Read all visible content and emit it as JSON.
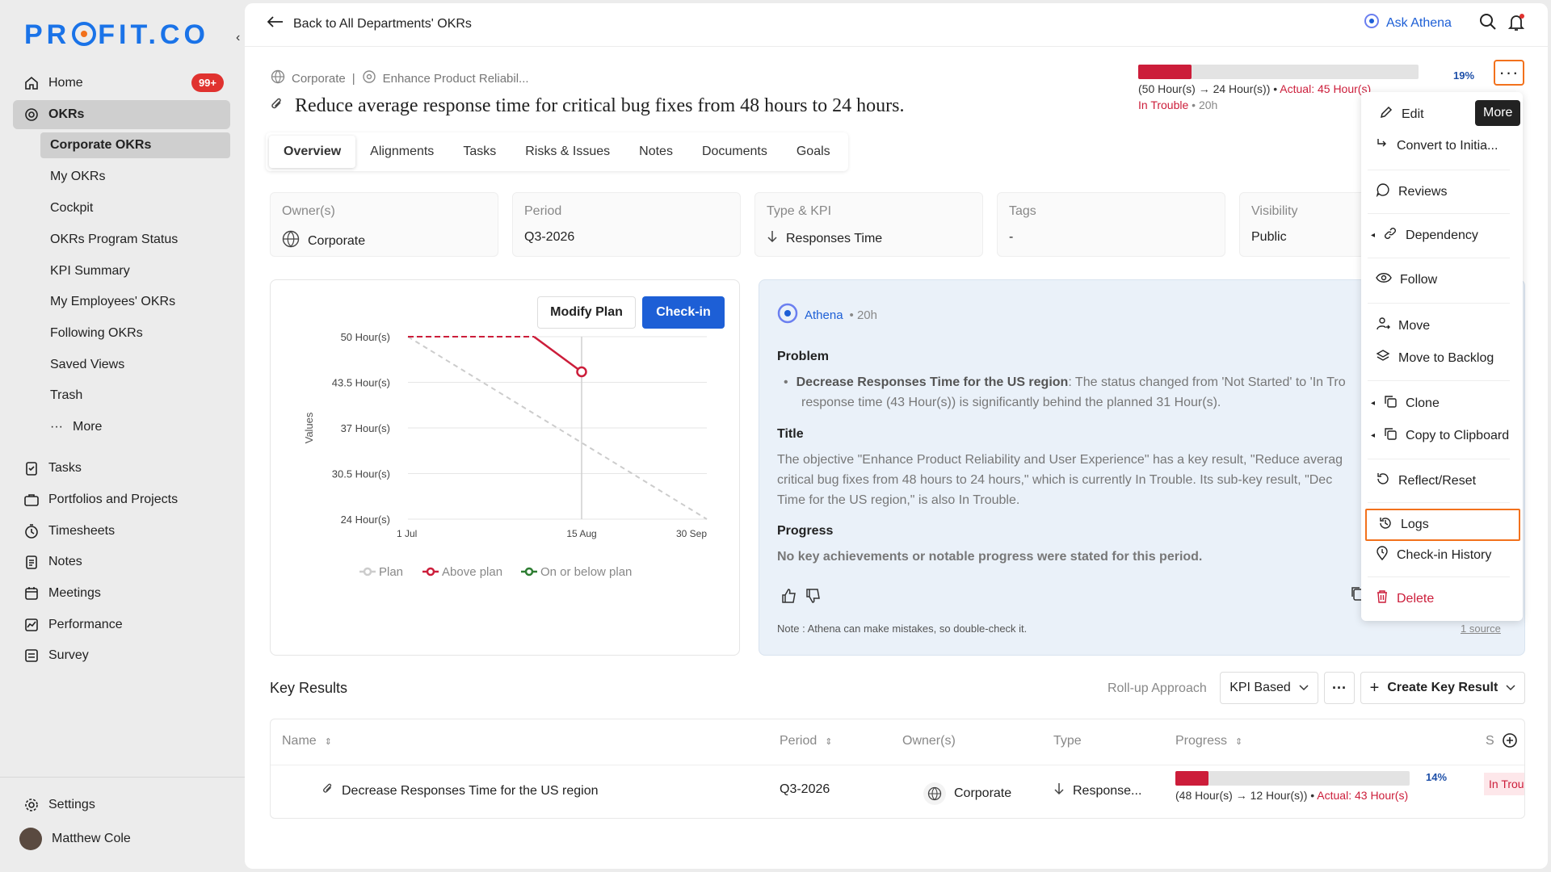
{
  "sidebar": {
    "logo": {
      "left": "PR",
      "right": "FIT.CO"
    },
    "nav": [
      {
        "label": "Home",
        "icon": "home-icon",
        "badge": "99+"
      },
      {
        "label": "OKRs",
        "icon": "target-icon"
      },
      {
        "label": "Tasks",
        "icon": "tasks-icon"
      },
      {
        "label": "Portfolios and Projects",
        "icon": "portfolio-icon"
      },
      {
        "label": "Timesheets",
        "icon": "timer-icon"
      },
      {
        "label": "Notes",
        "icon": "notes-icon"
      },
      {
        "label": "Meetings",
        "icon": "calendar-icon"
      },
      {
        "label": "Performance",
        "icon": "performance-icon"
      },
      {
        "label": "Survey",
        "icon": "survey-icon"
      }
    ],
    "okr_sub": [
      "Corporate OKRs",
      "My OKRs",
      "Cockpit",
      "OKRs Program Status",
      "KPI Summary",
      "My Employees' OKRs",
      "Following OKRs",
      "Saved Views",
      "Trash",
      "More"
    ],
    "settings": "Settings",
    "user": "Matthew Cole"
  },
  "topbar": {
    "back": "Back to All Departments' OKRs",
    "ask": "Ask Athena"
  },
  "breadcrumb": {
    "first": "Corporate",
    "sep": "|",
    "second": "Enhance Product Reliabil..."
  },
  "title": "Reduce average response time for critical bug fixes from 48 hours to 24 hours.",
  "progress": {
    "percent": 19,
    "percent_label": "19%",
    "start": "(50 Hour(s)",
    "target": "24 Hour(s))",
    "actual": "Actual: 45 Hour(s)",
    "status": "In Trouble",
    "age": "20h"
  },
  "tabs": [
    "Overview",
    "Alignments",
    "Tasks",
    "Risks & Issues",
    "Notes",
    "Documents",
    "Goals"
  ],
  "info": [
    {
      "label": "Owner(s)",
      "value": "Corporate"
    },
    {
      "label": "Period",
      "value": "Q3-2026"
    },
    {
      "label": "Type & KPI",
      "value": "Responses Time"
    },
    {
      "label": "Tags",
      "value": "-"
    },
    {
      "label": "Visibility",
      "value": "Public"
    }
  ],
  "chart_buttons": {
    "modify": "Modify Plan",
    "checkin": "Check-in"
  },
  "chart_data": {
    "type": "line",
    "ylabel": "Values",
    "y_ticks": [
      "50 Hour(s)",
      "43.5 Hour(s)",
      "37 Hour(s)",
      "30.5 Hour(s)",
      "24 Hour(s)"
    ],
    "ylim": [
      24,
      50
    ],
    "x_ticks": [
      "1 Jul",
      "15 Aug",
      "30 Sep"
    ],
    "series": [
      {
        "name": "Plan",
        "color": "#cccccc",
        "points": [
          [
            "1 Jul",
            50
          ],
          [
            "30 Sep",
            24
          ]
        ]
      },
      {
        "name": "Above plan",
        "color": "#cc1d3a",
        "points": [
          [
            "1 Jul",
            50
          ],
          [
            "1 Aug",
            50
          ],
          [
            "15 Aug",
            45
          ]
        ]
      },
      {
        "name": "On or below plan",
        "color": "#2e7d32",
        "points": []
      }
    ],
    "legend": [
      "Plan",
      "Above plan",
      "On or below plan"
    ]
  },
  "athena": {
    "name": "Athena",
    "age": "• 20h",
    "problem_h": "Problem",
    "problem_b": "Decrease Responses Time for the US region",
    "problem_t": ": The status changed from 'Not Started' to 'In Tro",
    "problem_t2": "response time (43 Hour(s)) is significantly behind the planned 31 Hour(s).",
    "title_h": "Title",
    "title_1": "The objective \"Enhance Product Reliability and User Experience\" has a key result, \"Reduce averag",
    "title_2": "critical bug fixes from 48 hours to 24 hours,\" which is currently In Trouble. Its sub-key result, \"Dec",
    "title_3": "Time for the US region,\" is also In Trouble.",
    "progress_h": "Progress",
    "progress_t": "No key achievements or notable progress were stated for this period.",
    "note": "Note : Athena can make mistakes, so double-check it.",
    "source": "1 source"
  },
  "menu": {
    "tooltip": "More",
    "items": [
      "Edit",
      "Convert to Initia...",
      "Reviews",
      "Dependency",
      "Follow",
      "Move",
      "Move to Backlog",
      "Clone",
      "Copy to Clipboard",
      "Reflect/Reset",
      "Logs",
      "Check-in History",
      "Delete"
    ]
  },
  "key_results": {
    "title": "Key Results",
    "rollup_label": "Roll-up Approach",
    "rollup_value": "KPI Based",
    "create": "Create Key Result",
    "columns": [
      "Name",
      "Period",
      "Owner(s)",
      "Type",
      "Progress",
      "S"
    ],
    "row": {
      "name": "Decrease Responses Time for the US region",
      "period": "Q3-2026",
      "owner": "Corporate",
      "type": "Response...",
      "percent": 14,
      "percent_label": "14%",
      "start": "(48 Hour(s)",
      "target": "12 Hour(s))",
      "actual": "Actual: 43 Hour(s)",
      "status": "In Trou"
    }
  },
  "colors": {
    "accent": "#1d5fd6",
    "danger": "#cc1d3a",
    "highlight": "#f2711c"
  }
}
